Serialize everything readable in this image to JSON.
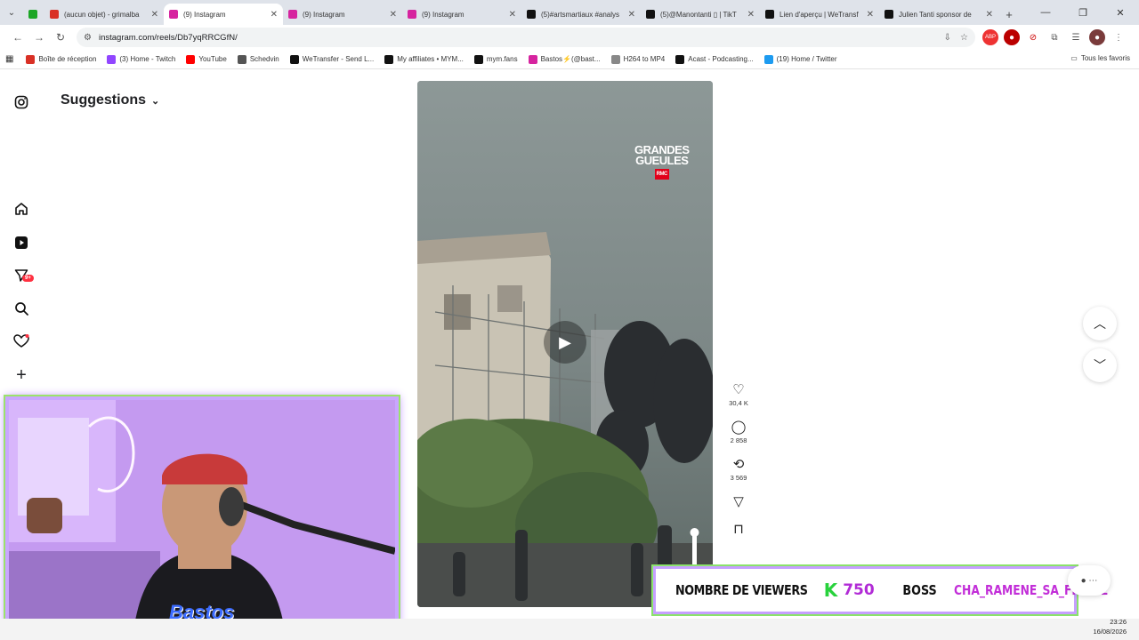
{
  "browser": {
    "tabs": [
      {
        "title": "",
        "favicon": "kick-icon",
        "color": "#1ca626"
      },
      {
        "title": "(aucun objet) - grimalba",
        "favicon": "gmail-icon",
        "color": "#d93025"
      },
      {
        "title": "(9) Instagram",
        "favicon": "instagram-icon",
        "color": "#d6249f",
        "active": true
      },
      {
        "title": "(9) Instagram",
        "favicon": "instagram-icon",
        "color": "#d6249f"
      },
      {
        "title": "(9) Instagram",
        "favicon": "instagram-icon",
        "color": "#d6249f"
      },
      {
        "title": "(5)#artsmartiaux #analys",
        "favicon": "tiktok-icon",
        "color": "#111111"
      },
      {
        "title": "(5)@Manontanti ▯ | TikT",
        "favicon": "tiktok-icon",
        "color": "#111111"
      },
      {
        "title": "Lien d'aperçu | WeTransf",
        "favicon": "wetransfer-icon",
        "color": "#111111"
      },
      {
        "title": "Julien Tanti sponsor de",
        "favicon": "tiktok-icon",
        "color": "#111111"
      }
    ],
    "url": "instagram.com/reels/Db7yqRRCGfN/",
    "bookmarks": [
      {
        "label": "Boîte de réception",
        "icon": "gmail-icon",
        "color": "#d93025"
      },
      {
        "label": "(3) Home - Twitch",
        "icon": "twitch-icon",
        "color": "#9146ff"
      },
      {
        "label": "YouTube",
        "icon": "youtube-icon",
        "color": "#ff0000"
      },
      {
        "label": "Schedvin",
        "icon": "dash-icon",
        "color": "#555555"
      },
      {
        "label": "WeTransfer - Send L...",
        "icon": "wetransfer-icon",
        "color": "#111111"
      },
      {
        "label": "My affiliates • MYM...",
        "icon": "mym-icon",
        "color": "#111111"
      },
      {
        "label": "mym.fans",
        "icon": "mym-icon",
        "color": "#111111"
      },
      {
        "label": "Bastos⚡(@bast...",
        "icon": "instagram-icon",
        "color": "#d6249f"
      },
      {
        "label": "H264 to MP4",
        "icon": "converter-icon",
        "color": "#888888"
      },
      {
        "label": "Acast - Podcasting...",
        "icon": "acast-icon",
        "color": "#111111"
      },
      {
        "label": "(19) Home / Twitter",
        "icon": "twitter-icon",
        "color": "#1d9bf0"
      }
    ],
    "all_bookmarks": "Tous les favoris"
  },
  "instagram": {
    "header": "Suggestions",
    "notif_badge": "9+",
    "reel_logo_line1": "GRANDES",
    "reel_logo_line2": "GUEULES",
    "reel_logo_badge": "RMC",
    "likes": "30,4 K",
    "comments": "2 858",
    "reposts": "3 569"
  },
  "overlay": {
    "streamer_name": "Bastos",
    "viewers_label": "NOMBRE DE VIEWERS",
    "viewers_count": "750",
    "boss_label": "BOSS",
    "boss_user": "CHA_RAMENE_SA_FRAISE"
  },
  "clock": {
    "time": "23:26",
    "date": "16/08/2026"
  }
}
